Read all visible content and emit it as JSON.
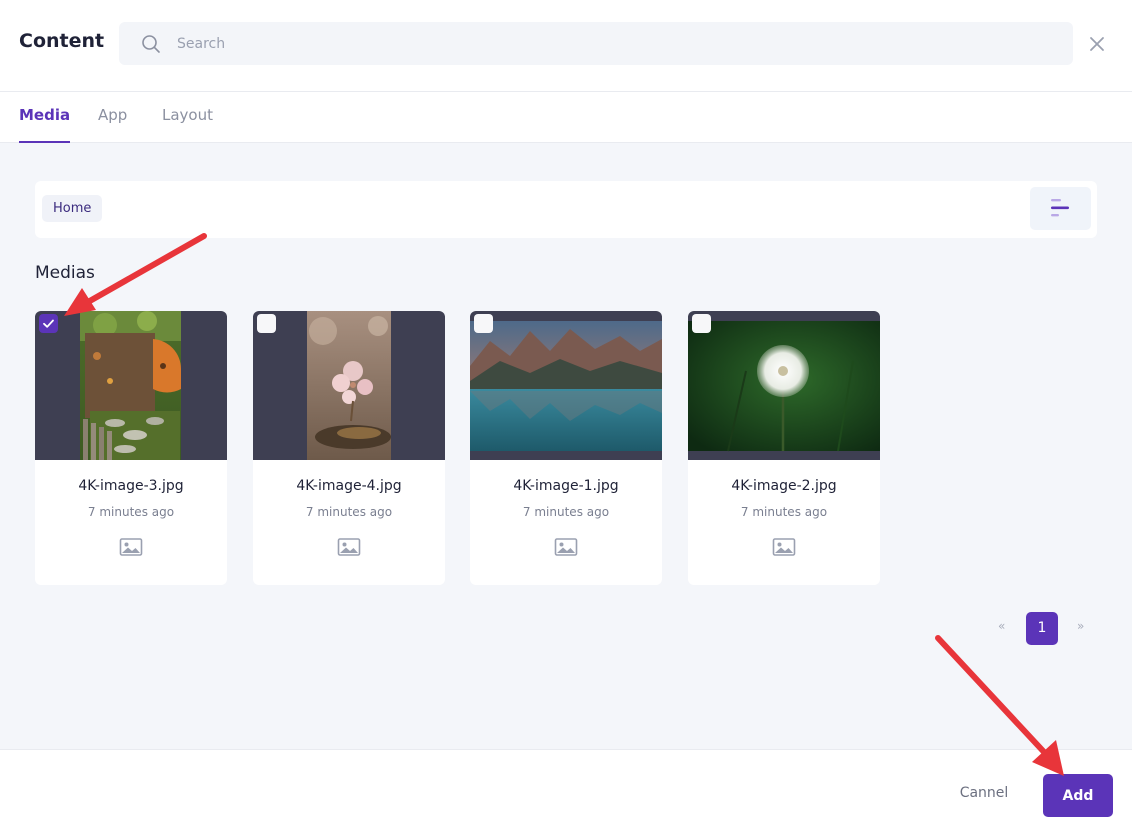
{
  "header": {
    "title": "Content",
    "search_placeholder": "Search",
    "search_value": ""
  },
  "tabs": [
    {
      "label": "Media",
      "active": true
    },
    {
      "label": "App",
      "active": false
    },
    {
      "label": "Layout",
      "active": false
    }
  ],
  "breadcrumb": {
    "home": "Home"
  },
  "section_title": "Medias",
  "media": [
    {
      "filename": "4K-image-3.jpg",
      "time": "7 minutes ago",
      "selected": true
    },
    {
      "filename": "4K-image-4.jpg",
      "time": "7 minutes ago",
      "selected": false
    },
    {
      "filename": "4K-image-1.jpg",
      "time": "7 minutes ago",
      "selected": false
    },
    {
      "filename": "4K-image-2.jpg",
      "time": "7 minutes ago",
      "selected": false
    }
  ],
  "pagination": {
    "prev": "«",
    "current": "1",
    "next": "»"
  },
  "footer": {
    "cancel_label": "Cannel",
    "add_label": "Add"
  },
  "colors": {
    "accent": "#5b34b8",
    "annotation_arrow": "#e8353a"
  }
}
